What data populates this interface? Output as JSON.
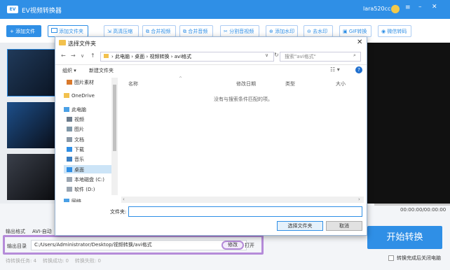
{
  "app": {
    "logo_text": "EV",
    "title": "EV视频转换器",
    "username": "lara520cc"
  },
  "toolbar": {
    "add_file": "+ 添加文件",
    "add_folder": "添加文件夹",
    "tools": [
      {
        "label": "高清压缩",
        "icon": "compress-icon"
      },
      {
        "label": "合并视频",
        "icon": "merge-video-icon"
      },
      {
        "label": "合并音频",
        "icon": "merge-audio-icon"
      },
      {
        "label": "分割音视频",
        "icon": "split-icon"
      },
      {
        "label": "添加水印",
        "icon": "add-watermark-icon"
      },
      {
        "label": "去水印",
        "icon": "remove-watermark-icon"
      },
      {
        "label": "GIF转换",
        "icon": "gif-icon"
      },
      {
        "label": "微信转码",
        "icon": "wechat-icon"
      }
    ]
  },
  "player": {
    "time": "00:00:00/00:00:00"
  },
  "output": {
    "format_label": "输出格式",
    "format_value": "AVI-自动",
    "dir_label": "输出目录",
    "dir_value": "C:/Users/Administrator/Desktop/视频转换/avi格式",
    "modify": "修改",
    "open": "打开"
  },
  "start_button": "开始转换",
  "shutdown_label": "转换完成后关闭电脑",
  "status": {
    "pending": "待转换任务: 4",
    "success": "转换成功: 0",
    "failed": "转换失败: 0"
  },
  "dialog": {
    "title": "选择文件夹",
    "close": "✕",
    "breadcrumb": "› 此电脑 › 桌面 › 视频转换 › avi格式",
    "search_placeholder": "搜索\"avi格式\"",
    "organize": "组织 ▾",
    "new_folder": "新建文件夹",
    "tree": [
      {
        "label": "图片素材",
        "icon": "folder-icon"
      },
      {
        "label": "OneDrive",
        "icon": "onedrive-icon"
      },
      {
        "label": "此电脑",
        "icon": "computer-icon"
      },
      {
        "label": "视频",
        "icon": "video-folder-icon"
      },
      {
        "label": "图片",
        "icon": "pictures-folder-icon"
      },
      {
        "label": "文档",
        "icon": "documents-folder-icon"
      },
      {
        "label": "下载",
        "icon": "downloads-folder-icon"
      },
      {
        "label": "音乐",
        "icon": "music-folder-icon"
      },
      {
        "label": "桌面",
        "icon": "desktop-folder-icon"
      },
      {
        "label": "本地磁盘 (C:)",
        "icon": "drive-c-icon"
      },
      {
        "label": "软件 (D:)",
        "icon": "drive-d-icon"
      },
      {
        "label": "网络",
        "icon": "network-icon"
      }
    ],
    "columns": [
      "名称",
      "修改日期",
      "类型",
      "大小"
    ],
    "empty_message": "没有与搜索条件匹配的项。",
    "folder_label": "文件夹:",
    "folder_value": "",
    "select_button": "选择文件夹",
    "cancel_button": "取消"
  },
  "colors": {
    "accent": "#2f8fe6",
    "highlight": "#b58bd9"
  }
}
